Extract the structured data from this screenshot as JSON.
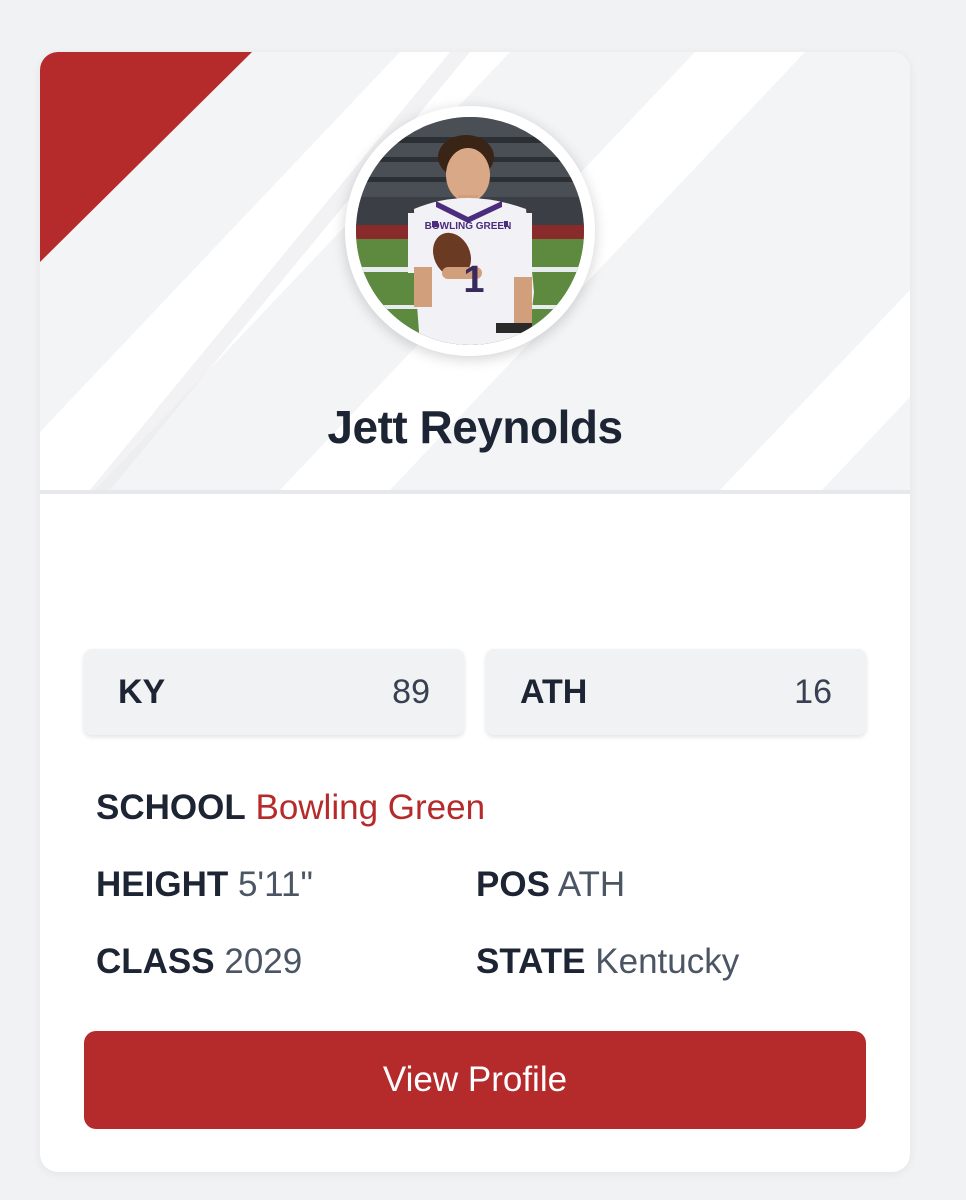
{
  "player": {
    "name": "Jett Reynolds",
    "photo_alt": "Player photo",
    "jersey_text": "BOWLING GREEN",
    "jersey_number": "1"
  },
  "rankings": [
    {
      "label": "KY",
      "value": "89"
    },
    {
      "label": "ATH",
      "value": "16"
    }
  ],
  "details": {
    "school_label": "SCHOOL",
    "school_value": "Bowling Green",
    "height_label": "HEIGHT",
    "height_value": "5'11\"",
    "pos_label": "POS",
    "pos_value": "ATH",
    "class_label": "CLASS",
    "class_value": "2029",
    "state_label": "STATE",
    "state_value": "Kentucky"
  },
  "actions": {
    "view_profile_label": "View Profile"
  },
  "colors": {
    "accent": "#b52a2a",
    "text_dark": "#1d2433",
    "text_muted": "#4b5563",
    "page_bg": "#f1f2f4"
  }
}
